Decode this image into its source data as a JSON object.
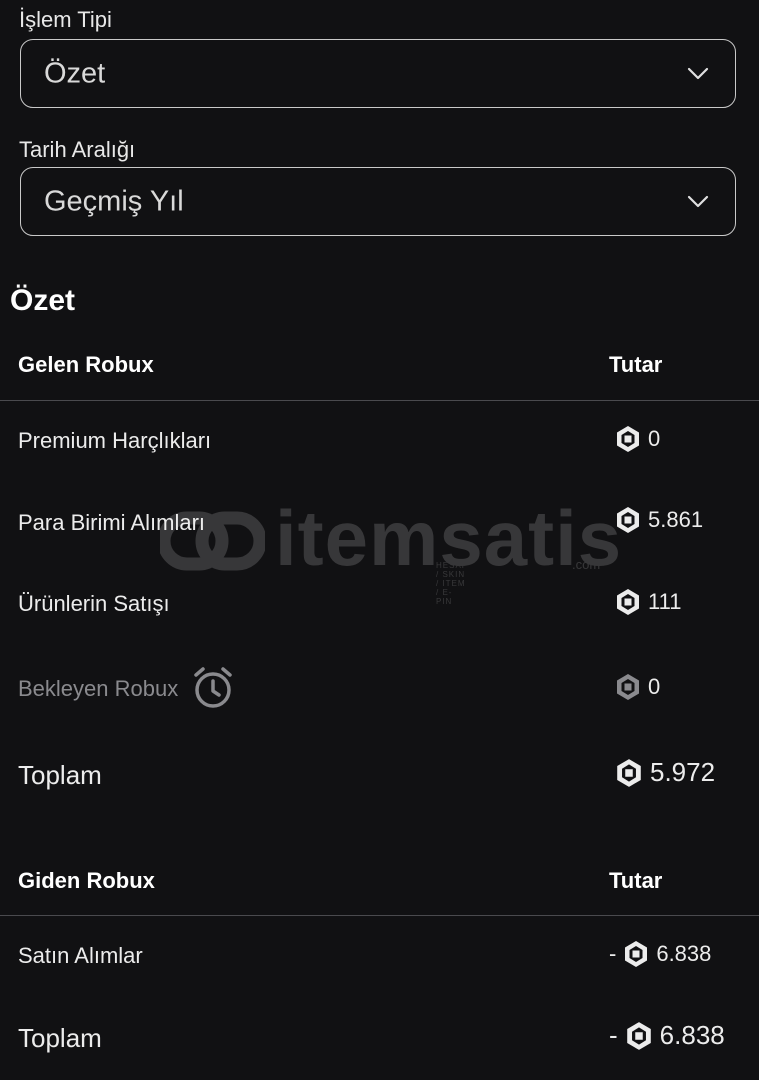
{
  "filters": {
    "transaction_type": {
      "label": "İşlem Tipi",
      "value": "Özet"
    },
    "date_range": {
      "label": "Tarih Aralığı",
      "value": "Geçmiş Yıl"
    }
  },
  "summary_title": "Özet",
  "incoming": {
    "header": "Gelen Robux",
    "amount_header": "Tutar",
    "rows": [
      {
        "label": "Premium Harçlıkları",
        "amount": "0"
      },
      {
        "label": "Para Birimi Alımları",
        "amount": "5.861"
      },
      {
        "label": "Ürünlerin Satışı",
        "amount": "111"
      },
      {
        "label": "Bekleyen Robux",
        "amount": "0"
      }
    ],
    "total_label": "Toplam",
    "total_amount": "5.972"
  },
  "outgoing": {
    "header": "Giden Robux",
    "amount_header": "Tutar",
    "rows": [
      {
        "label": "Satın Alımlar",
        "sign": "-",
        "amount": "6.838"
      }
    ],
    "total_label": "Toplam",
    "total_sign": "-",
    "total_amount": "6.838"
  },
  "watermark": {
    "text": "itemsatis",
    "sub": "HESAP / SKIN / ITEM / E-PIN",
    "suffix": ".com"
  },
  "icons": {
    "currency": "robux-icon",
    "pending": "alarm-clock-icon",
    "dropdown": "chevron-down-icon"
  }
}
